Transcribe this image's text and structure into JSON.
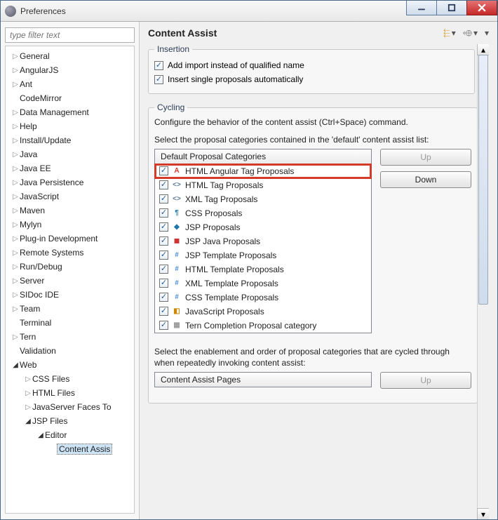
{
  "window": {
    "title": "Preferences"
  },
  "sidebar": {
    "filter_placeholder": "type filter text",
    "items": [
      {
        "label": "General",
        "depth": 0,
        "exp": "closed"
      },
      {
        "label": "AngularJS",
        "depth": 0,
        "exp": "closed"
      },
      {
        "label": "Ant",
        "depth": 0,
        "exp": "closed"
      },
      {
        "label": "CodeMirror",
        "depth": 0,
        "exp": "none"
      },
      {
        "label": "Data Management",
        "depth": 0,
        "exp": "closed"
      },
      {
        "label": "Help",
        "depth": 0,
        "exp": "closed"
      },
      {
        "label": "Install/Update",
        "depth": 0,
        "exp": "closed"
      },
      {
        "label": "Java",
        "depth": 0,
        "exp": "closed"
      },
      {
        "label": "Java EE",
        "depth": 0,
        "exp": "closed"
      },
      {
        "label": "Java Persistence",
        "depth": 0,
        "exp": "closed"
      },
      {
        "label": "JavaScript",
        "depth": 0,
        "exp": "closed"
      },
      {
        "label": "Maven",
        "depth": 0,
        "exp": "closed"
      },
      {
        "label": "Mylyn",
        "depth": 0,
        "exp": "closed"
      },
      {
        "label": "Plug-in Development",
        "depth": 0,
        "exp": "closed"
      },
      {
        "label": "Remote Systems",
        "depth": 0,
        "exp": "closed"
      },
      {
        "label": "Run/Debug",
        "depth": 0,
        "exp": "closed"
      },
      {
        "label": "Server",
        "depth": 0,
        "exp": "closed"
      },
      {
        "label": "SIDoc IDE",
        "depth": 0,
        "exp": "closed"
      },
      {
        "label": "Team",
        "depth": 0,
        "exp": "closed"
      },
      {
        "label": "Terminal",
        "depth": 0,
        "exp": "none"
      },
      {
        "label": "Tern",
        "depth": 0,
        "exp": "closed"
      },
      {
        "label": "Validation",
        "depth": 0,
        "exp": "none"
      },
      {
        "label": "Web",
        "depth": 0,
        "exp": "open"
      },
      {
        "label": "CSS Files",
        "depth": 1,
        "exp": "closed"
      },
      {
        "label": "HTML Files",
        "depth": 1,
        "exp": "closed"
      },
      {
        "label": "JavaServer Faces To",
        "depth": 1,
        "exp": "closed"
      },
      {
        "label": "JSP Files",
        "depth": 1,
        "exp": "open"
      },
      {
        "label": "Editor",
        "depth": 2,
        "exp": "open"
      },
      {
        "label": "Content Assis",
        "depth": 3,
        "exp": "none",
        "selected": true
      }
    ]
  },
  "main": {
    "title": "Content Assist",
    "insertion": {
      "legend": "Insertion",
      "opt1": "Add import instead of qualified name",
      "opt2": "Insert single proposals automatically"
    },
    "cycling": {
      "legend": "Cycling",
      "desc": "Configure the behavior of the content assist (Ctrl+Space) command.",
      "subhead": "Select the proposal categories contained in the 'default' content assist list:",
      "col_header": "Default Proposal Categories",
      "items": [
        {
          "label": "HTML Angular Tag Proposals",
          "icon": "angular",
          "hl": true
        },
        {
          "label": "HTML Tag Proposals",
          "icon": "tag"
        },
        {
          "label": "XML Tag Proposals",
          "icon": "tag"
        },
        {
          "label": "CSS Proposals",
          "icon": "css"
        },
        {
          "label": "JSP Proposals",
          "icon": "jsp"
        },
        {
          "label": "JSP Java Proposals",
          "icon": "jspj"
        },
        {
          "label": "JSP Template Proposals",
          "icon": "hash"
        },
        {
          "label": "HTML Template Proposals",
          "icon": "hash"
        },
        {
          "label": "XML Template Proposals",
          "icon": "hash"
        },
        {
          "label": "CSS Template Proposals",
          "icon": "hash"
        },
        {
          "label": "JavaScript Proposals",
          "icon": "js"
        },
        {
          "label": "Tern Completion Proposal category",
          "icon": "tern"
        }
      ],
      "up": "Up",
      "down": "Down",
      "footer": "Select the enablement and order of proposal categories that are cycled through when repeatedly invoking content assist:",
      "footer_col": "Content Assist Pages",
      "footer_up": "Up"
    }
  }
}
